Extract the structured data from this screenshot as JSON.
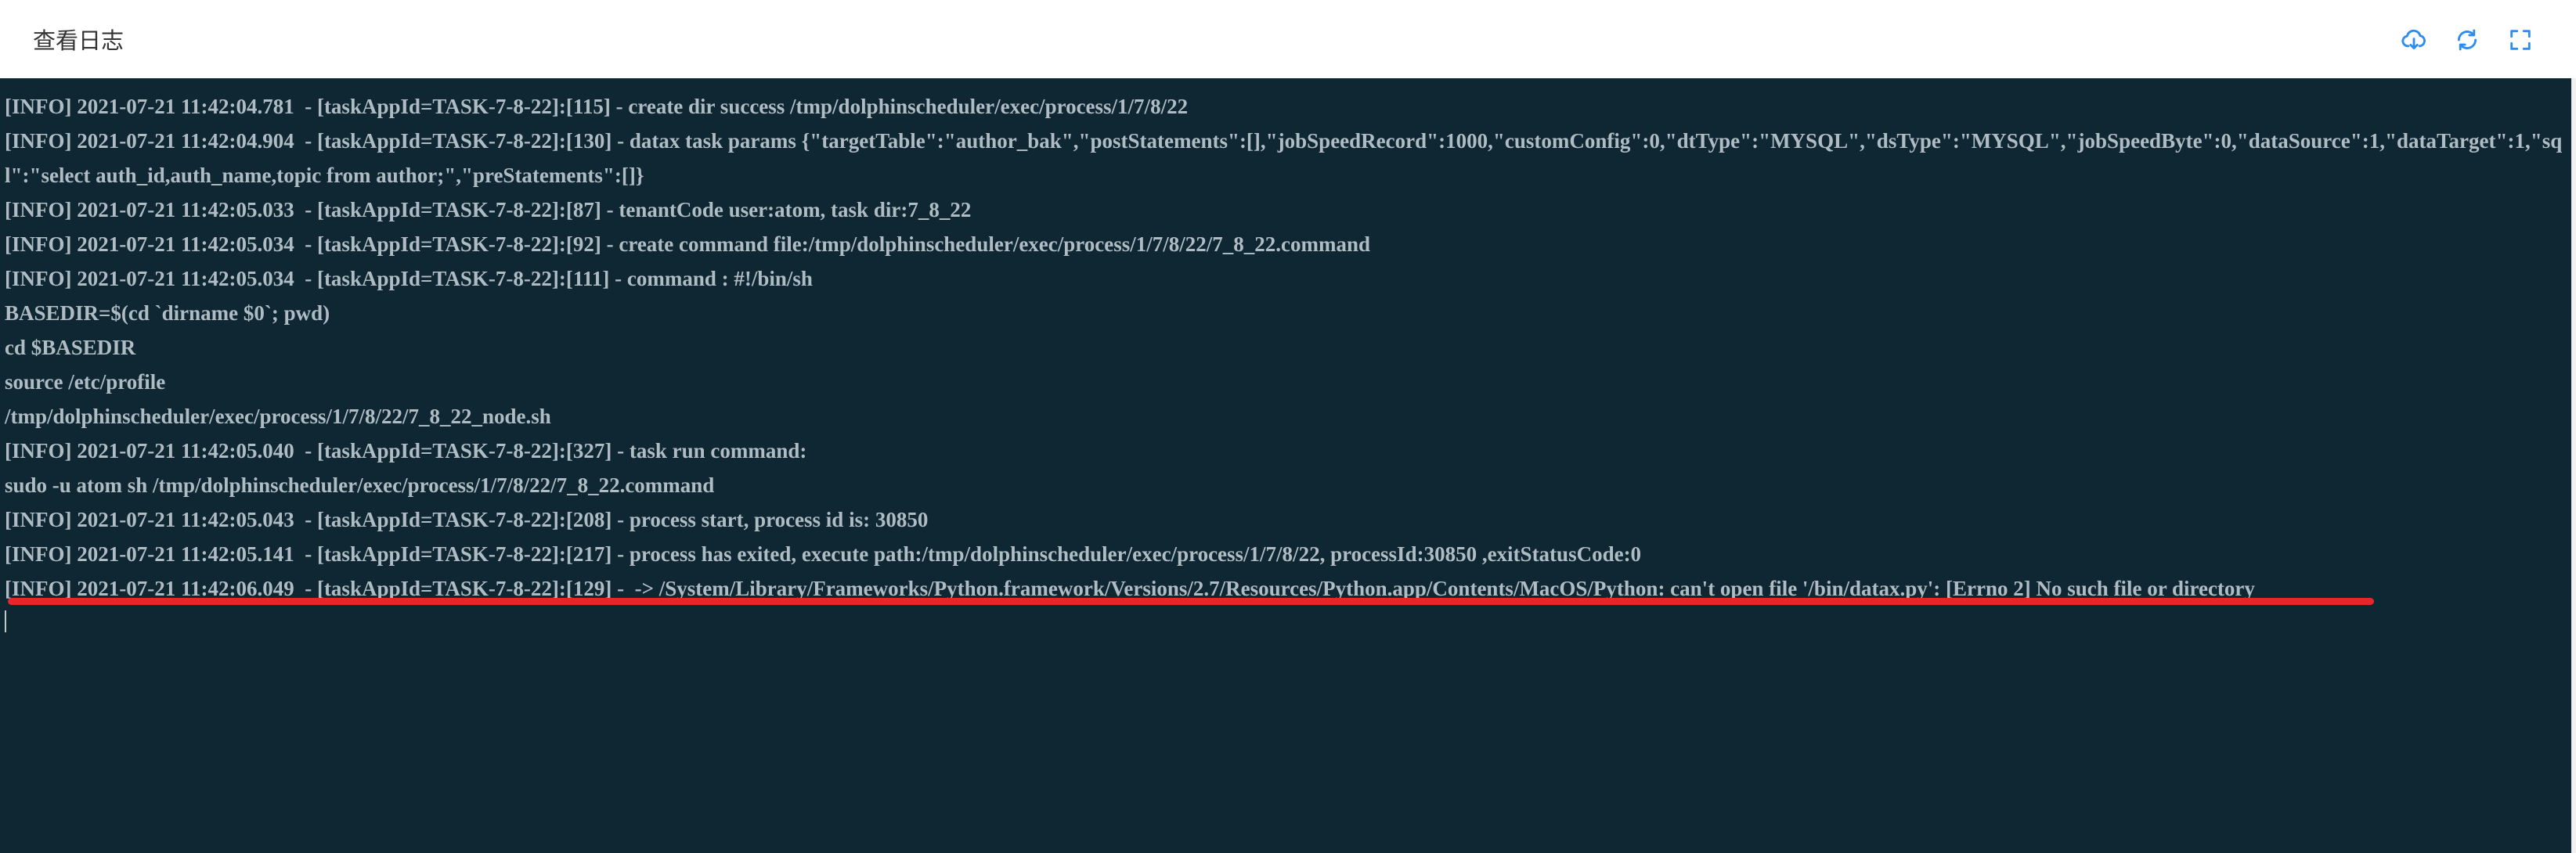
{
  "dialog": {
    "title": "查看日志"
  },
  "header_icons": [
    {
      "name": "cloud-download-icon"
    },
    {
      "name": "refresh-icon"
    },
    {
      "name": "fullscreen-icon"
    }
  ],
  "colors": {
    "log_background": "#0e2733",
    "log_text": "#b0bcc4",
    "icon_accent": "#2d8cf0",
    "highlight_underline": "#e5262b"
  },
  "log": {
    "lines": [
      "[INFO] 2021-07-21 11:42:04.781  - [taskAppId=TASK-7-8-22]:[115] - create dir success /tmp/dolphinscheduler/exec/process/1/7/8/22",
      "[INFO] 2021-07-21 11:42:04.904  - [taskAppId=TASK-7-8-22]:[130] - datax task params {\"targetTable\":\"author_bak\",\"postStatements\":[],\"jobSpeedRecord\":1000,\"customConfig\":0,\"dtType\":\"MYSQL\",\"dsType\":\"MYSQL\",\"jobSpeedByte\":0,\"dataSource\":1,\"dataTarget\":1,\"sql\":\"select auth_id,auth_name,topic from author;\",\"preStatements\":[]}",
      "[INFO] 2021-07-21 11:42:05.033  - [taskAppId=TASK-7-8-22]:[87] - tenantCode user:atom, task dir:7_8_22",
      "[INFO] 2021-07-21 11:42:05.034  - [taskAppId=TASK-7-8-22]:[92] - create command file:/tmp/dolphinscheduler/exec/process/1/7/8/22/7_8_22.command",
      "[INFO] 2021-07-21 11:42:05.034  - [taskAppId=TASK-7-8-22]:[111] - command : #!/bin/sh",
      "BASEDIR=$(cd `dirname $0`; pwd)",
      "cd $BASEDIR",
      "source /etc/profile",
      "/tmp/dolphinscheduler/exec/process/1/7/8/22/7_8_22_node.sh",
      "[INFO] 2021-07-21 11:42:05.040  - [taskAppId=TASK-7-8-22]:[327] - task run command:",
      "sudo -u atom sh /tmp/dolphinscheduler/exec/process/1/7/8/22/7_8_22.command",
      "[INFO] 2021-07-21 11:42:05.043  - [taskAppId=TASK-7-8-22]:[208] - process start, process id is: 30850",
      "[INFO] 2021-07-21 11:42:05.141  - [taskAppId=TASK-7-8-22]:[217] - process has exited, execute path:/tmp/dolphinscheduler/exec/process/1/7/8/22, processId:30850 ,exitStatusCode:0",
      "[INFO] 2021-07-21 11:42:06.049  - [taskAppId=TASK-7-8-22]:[129] -  -> /System/Library/Frameworks/Python.framework/Versions/2.7/Resources/Python.app/Contents/MacOS/Python: can't open file '/bin/datax.py': [Errno 2] No such file or directory"
    ]
  }
}
